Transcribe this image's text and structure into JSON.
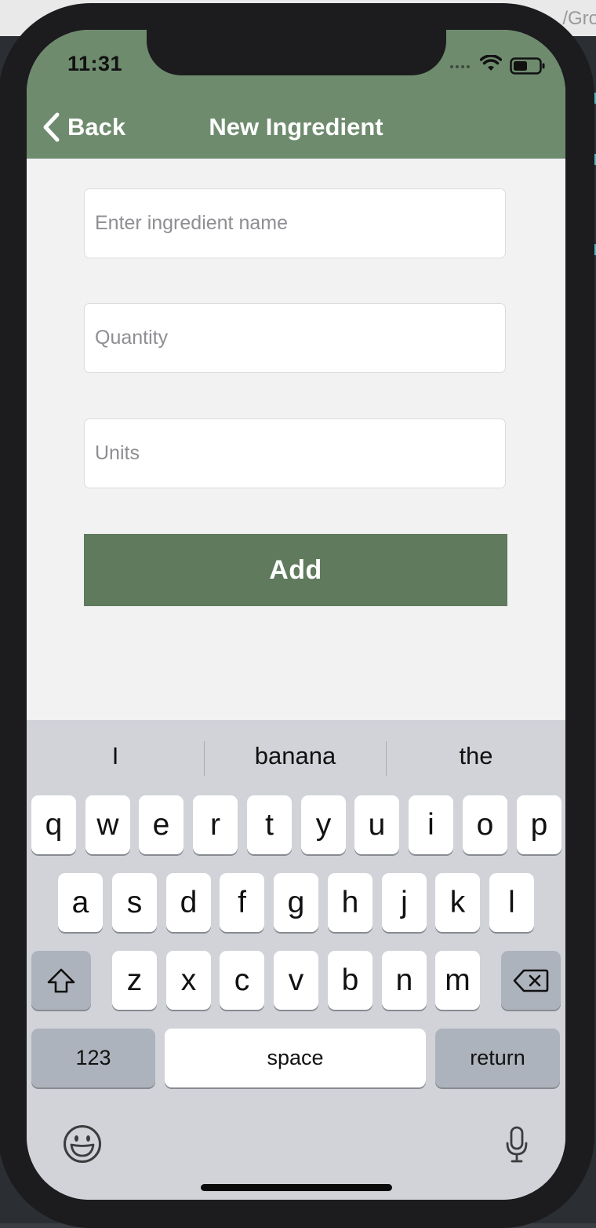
{
  "background": {
    "window_title_fragment": "/Gro"
  },
  "status_bar": {
    "time": "11:31"
  },
  "nav": {
    "back_label": "Back",
    "title": "New Ingredient"
  },
  "form": {
    "name_placeholder": "Enter ingredient name",
    "quantity_placeholder": "Quantity",
    "units_placeholder": "Units",
    "add_label": "Add"
  },
  "keyboard": {
    "suggestions": [
      "I",
      "banana",
      "the"
    ],
    "row1": [
      "q",
      "w",
      "e",
      "r",
      "t",
      "y",
      "u",
      "i",
      "o",
      "p"
    ],
    "row2": [
      "a",
      "s",
      "d",
      "f",
      "g",
      "h",
      "j",
      "k",
      "l"
    ],
    "row3": [
      "z",
      "x",
      "c",
      "v",
      "b",
      "n",
      "m"
    ],
    "numbers_label": "123",
    "space_label": "space",
    "return_label": "return"
  },
  "icons": {
    "back": "chevron-left-icon",
    "shift": "shift-arrow-icon",
    "delete": "backspace-icon",
    "emoji": "emoji-smiley-icon",
    "mic": "microphone-icon",
    "wifi": "wifi-icon",
    "battery": "battery-icon"
  },
  "colors": {
    "nav_bar": "#6e8b6e",
    "add_button": "#5f7a5d",
    "screen_background": "#f2f2f2",
    "keyboard_background": "#d1d3d9"
  }
}
